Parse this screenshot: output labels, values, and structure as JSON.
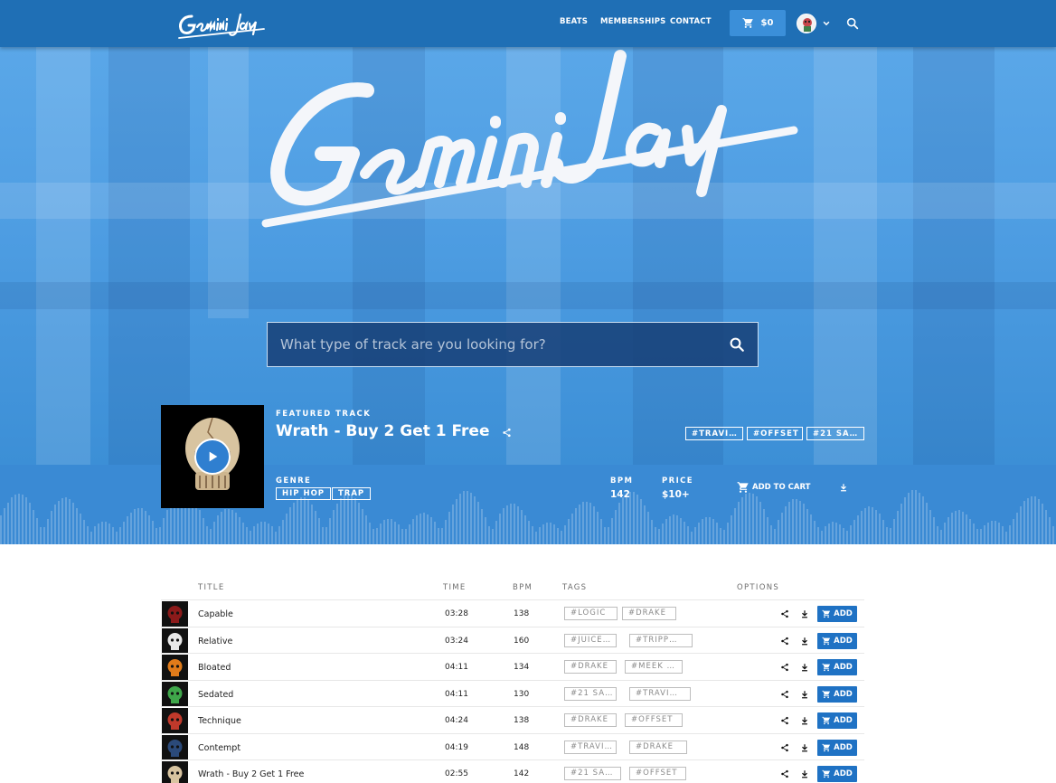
{
  "brand": {
    "name": "Gemini Jay"
  },
  "nav": {
    "links": [
      "BEATS",
      "MEMBERSHIPS",
      "CONTACT"
    ],
    "cart_total": "$0"
  },
  "hero": {
    "search_placeholder": "What type of track are you looking for?"
  },
  "featured": {
    "label": "FEATURED TRACK",
    "title": "Wrath - Buy 2 Get 1 Free",
    "tags": [
      "#TRAVI…",
      "#OFFSET",
      "#21 SA…"
    ],
    "genre_label": "GENRE",
    "genres": [
      "HIP HOP",
      "TRAP"
    ],
    "bpm_label": "BPM",
    "bpm": "142",
    "price_label": "PRICE",
    "price": "$10+",
    "add_to_cart": "ADD TO CART"
  },
  "table": {
    "headers": {
      "title": "TITLE",
      "time": "TIME",
      "bpm": "BPM",
      "tags": "TAGS",
      "options": "OPTIONS"
    },
    "add_label": "ADD",
    "rows": [
      {
        "title": "Capable",
        "time": "03:28",
        "bpm": "138",
        "tags": [
          "#LOGIC",
          "#DRAKE"
        ]
      },
      {
        "title": "Relative",
        "time": "03:24",
        "bpm": "160",
        "tags": [
          "#JUICE…",
          "#TRIPP…"
        ]
      },
      {
        "title": "Bloated",
        "time": "04:11",
        "bpm": "134",
        "tags": [
          "#DRAKE",
          "#MEEK …"
        ]
      },
      {
        "title": "Sedated",
        "time": "04:11",
        "bpm": "130",
        "tags": [
          "#21 SA…",
          "#TRAVI…"
        ]
      },
      {
        "title": "Technique",
        "time": "04:24",
        "bpm": "138",
        "tags": [
          "#DRAKE",
          "#OFFSET"
        ]
      },
      {
        "title": "Contempt",
        "time": "04:19",
        "bpm": "148",
        "tags": [
          "#TRAVI…",
          "#DRAKE"
        ]
      },
      {
        "title": "Wrath - Buy 2 Get 1 Free",
        "time": "02:55",
        "bpm": "142",
        "tags": [
          "#21 SA…",
          "#OFFSET"
        ]
      }
    ]
  },
  "colors": {
    "nav_bg": "#1f6fb5",
    "hero_bg": "#4f9ee3",
    "featured_bar": "#3a8ad4",
    "add_button": "#1f72c4",
    "cart_button": "#3b8fd9"
  }
}
